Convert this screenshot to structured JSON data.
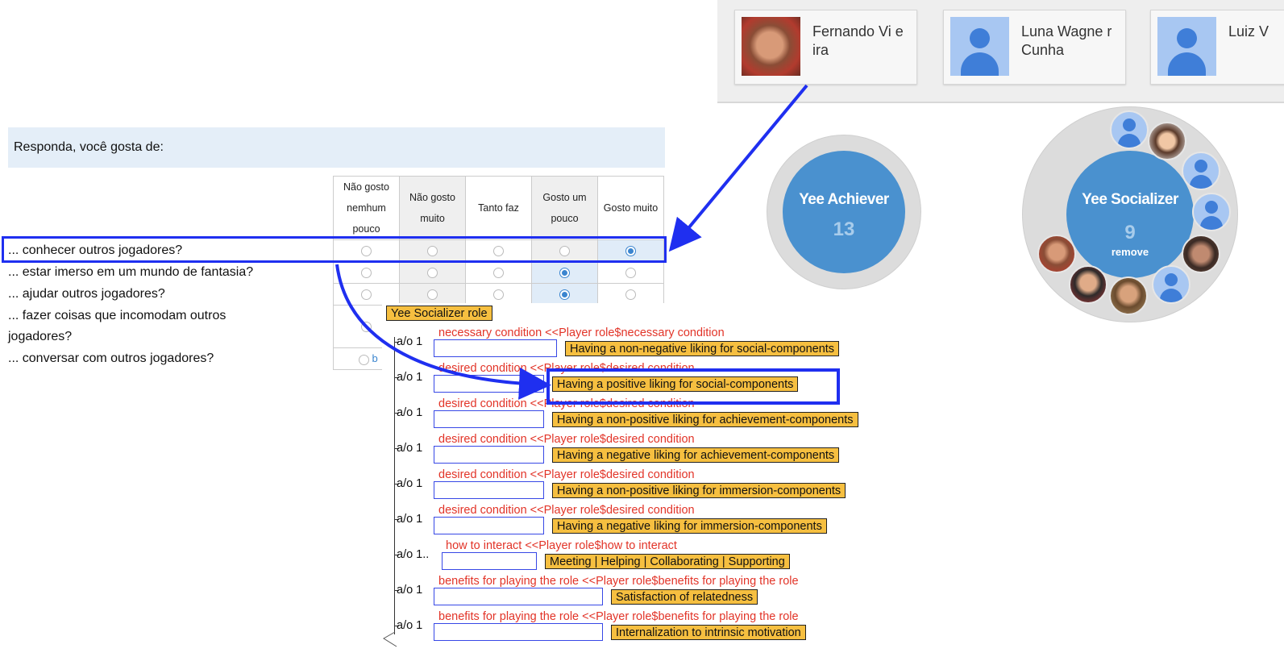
{
  "contacts": [
    {
      "name": "Fernando Vi eira",
      "avatar_icon": "user-photo"
    },
    {
      "name": "Luna Wagne r Cunha",
      "avatar_icon": "user-silhouette-icon"
    },
    {
      "name": "Luiz V",
      "avatar_icon": "user-silhouette-icon"
    }
  ],
  "circles": [
    {
      "title": "Yee Achiever",
      "count": "13"
    },
    {
      "title": "Yee Socializer",
      "count": "9",
      "action": "remove"
    }
  ],
  "questionnaire": {
    "header": "Responda, você gosta de:",
    "columns": [
      "Não gosto nemhum pouco",
      "Não gosto muito",
      "Tanto faz",
      "Gosto um pouco",
      "Gosto muito"
    ],
    "questions": [
      {
        "text": "... conhecer outros jogadores?",
        "selected": 4
      },
      {
        "text": "... estar imerso em um mundo de fantasia?",
        "selected": 3
      },
      {
        "text": "... ajudar outros jogadores?",
        "selected": 3
      },
      {
        "text": "... fazer coisas que incomodam outros",
        "continuation": "jogadores?",
        "selected": null
      },
      {
        "text": "... conversar com outros jogadores?",
        "selected": null
      }
    ],
    "fragment": "b"
  },
  "editor": {
    "root": "Yee Socializer role",
    "slots": [
      {
        "card": "a/o 1",
        "condition": "necessary condition  <<Player role$necessary condition",
        "value": "Having a non-negative liking for social-components"
      },
      {
        "card": "a/o 1",
        "condition": "desired condition  <<Player role$desired condition",
        "value": "Having a positive liking for social-components"
      },
      {
        "card": "a/o 1",
        "condition": "desired condition  <<Player role$desired condition",
        "value": "Having a non-positive liking for achievement-components"
      },
      {
        "card": "a/o 1",
        "condition": "desired condition  <<Player role$desired condition",
        "value": "Having a negative liking for achievement-components"
      },
      {
        "card": "a/o 1",
        "condition": "desired condition  <<Player role$desired condition",
        "value": "Having a non-positive liking for immersion-components"
      },
      {
        "card": "a/o 1",
        "condition": "desired condition  <<Player role$desired condition",
        "value": "Having a negative liking for immersion-components"
      },
      {
        "card": "a/o 1..",
        "condition": "how to interact  <<Player role$how to interact",
        "value": "Meeting | Helping | Collaborating | Supporting"
      },
      {
        "card": "a/o 1",
        "condition": "benefits for playing the role  <<Player role$benefits for playing the role",
        "value": "Satisfaction of relatedness"
      },
      {
        "card": "a/o 1",
        "condition": "benefits for playing the role  <<Player role$benefits for playing the role",
        "value": "Internalization to intrinsic motivation"
      }
    ]
  },
  "colors": {
    "highlight": "#1f2ff0",
    "circle": "#4a91cf",
    "tag": "#f6bf40",
    "condition": "#e23428"
  }
}
